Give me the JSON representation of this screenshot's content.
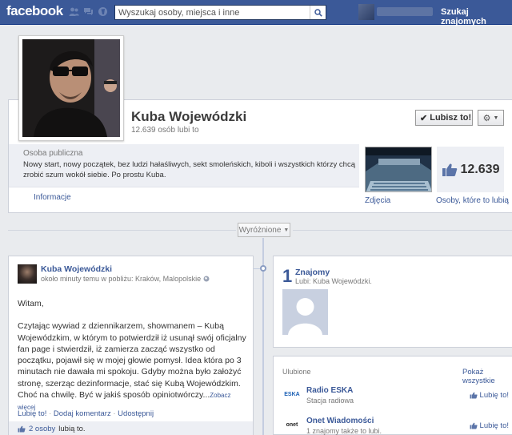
{
  "topbar": {
    "logo": "facebook",
    "search_placeholder": "Wyszukaj osoby, miejsca i inne",
    "find_friends": "Szukaj znajomych"
  },
  "page": {
    "name": "Kuba Wojewódzki",
    "likes_short": "12.639 osób lubi to",
    "like_button": "Lubisz to!",
    "category": "Osoba publiczna",
    "description": "Nowy start, nowy początek, bez ludzi hałaśliwych, sekt smoleńskich, kiboli i wszystkich którzy chcą zrobić szum wokół siebie. Po prostu Kuba.",
    "info_link": "Informacje",
    "photos_label": "Zdjęcia",
    "likes_count": "12.639",
    "likes_label": "Osoby, które to lubią"
  },
  "timeline": {
    "filter": "Wyróżnione"
  },
  "post": {
    "author": "Kuba Wojewódzki",
    "meta": "około minuty temu w pobliżu: Kraków, Malopolskie",
    "greeting": "Witam,",
    "body": "Czytając wywiad z dziennikarzem, showmanem – Kubą Wojewódzkim, w którym to potwierdził iż usunął swój oficjalny fan page i stwierdził, iż zamierza zacząć wszystko od początku, pojawił się w mojej głowie pomysł. Idea która po 3 minutach nie dawała mi spokoju. Gdyby można było założyć stronę, szerząc dezinformacje, stać się Kubą Wojewódzkim. Choć na chwilę. Być w jakiś sposób opiniotwórczy...",
    "see_more": "Zobacz więcej",
    "action_like": "Lubię to!",
    "action_comment": "Dodaj komentarz",
    "action_share": "Udostępnij",
    "likes_count_link": "2 osoby",
    "likes_suffix": "lubią to."
  },
  "friends_card": {
    "count": "1",
    "title": "Znajomy",
    "subtitle": "Lubi: Kuba Wojewódzki."
  },
  "likes_card": {
    "header": "Ulubione",
    "see_all": "Pokaż wszystkie",
    "items": [
      {
        "logo": "ESKA",
        "name": "Radio ESKA",
        "desc": "Stacja radiowa",
        "like": "Lubię to!"
      },
      {
        "logo": "onet",
        "name": "Onet Wiadomości",
        "desc": "1 znajomy także to lubi.",
        "like": "Lubię to!"
      }
    ]
  },
  "colors": {
    "brand_blue": "#3b5998",
    "link_blue": "#3b5998",
    "background": "#e9ebee"
  }
}
